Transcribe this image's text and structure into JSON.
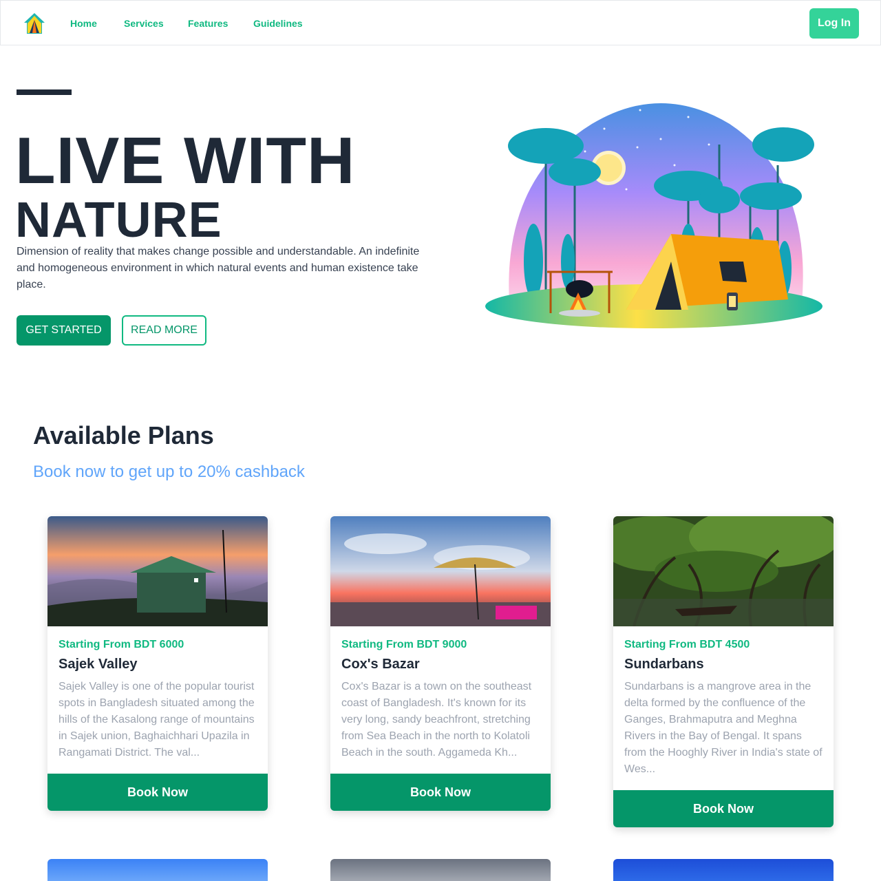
{
  "nav": {
    "logo_icon": "tent-home-icon",
    "links": [
      "Home",
      "Services",
      "Features",
      "Guidelines"
    ],
    "login_label": "Log In"
  },
  "hero": {
    "title_line1": "LIVE WITH",
    "title_line2": "NATURE",
    "description": "Dimension of reality that makes change possible and understandable. An indefinite and homogeneous environment in which natural events and human existence take place.",
    "primary_button": "GET STARTED",
    "secondary_button": "READ MORE"
  },
  "plans": {
    "title": "Available Plans",
    "subtitle": "Book now to get up to 20% cashback",
    "cards": [
      {
        "price": "Starting From BDT 6000",
        "name": "Sajek Valley",
        "description": "Sajek Valley is one of the popular tourist spots in Bangladesh situated among the hills of the Kasalong range of mountains in Sajek union, Baghaichhari Upazila in Rangamati District. The val...",
        "button": "Book Now"
      },
      {
        "price": "Starting From BDT 9000",
        "name": "Cox's Bazar",
        "description": "Cox's Bazar is a town on the southeast coast of Bangladesh. It's known for its very long, sandy beachfront, stretching from Sea Beach in the north to Kolatoli Beach in the south. Aggameda Kh...",
        "button": "Book Now"
      },
      {
        "price": "Starting From BDT 4500",
        "name": "Sundarbans",
        "description": "Sundarbans is a mangrove area in the delta formed by the confluence of the Ganges, Brahmaputra and Meghna Rivers in the Bay of Bengal. It spans from the Hooghly River in India's state of Wes...",
        "button": "Book Now"
      }
    ]
  },
  "colors": {
    "accent": "#10b981",
    "button_green": "#059669",
    "login_green": "#34d399",
    "subtitle_blue": "#60a5fa",
    "heading": "#1f2937"
  }
}
